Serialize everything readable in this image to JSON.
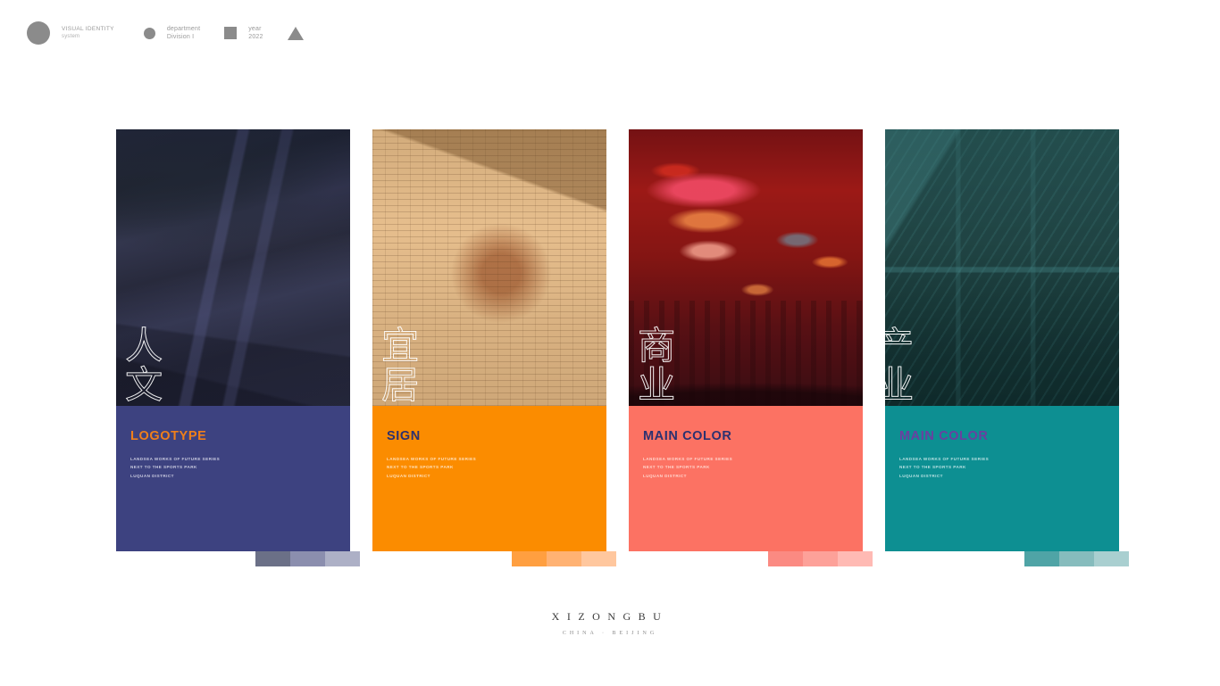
{
  "header": {
    "items": [
      {
        "icon": "circle-large-icon",
        "shape": "circle-lg",
        "line1": "VISUAL IDENTITY",
        "line2": "system"
      },
      {
        "icon": "circle-small-icon",
        "shape": "circle-sm",
        "line1": "department",
        "line2": "Division I"
      },
      {
        "icon": "square-icon",
        "shape": "square",
        "line1": "year",
        "line2": "2022"
      },
      {
        "icon": "triangle-icon",
        "shape": "triangle",
        "line1": "",
        "line2": ""
      }
    ]
  },
  "cards": [
    {
      "name": "logotype",
      "cjk": "人文",
      "title": "LOGOTYPE",
      "lines": [
        "LANDSEA WORKS OF FUTURE SERIES",
        "NEXT TO THE SPORTS PARK",
        "LUQUAN DISTRICT"
      ],
      "panel_color": "#3d4280",
      "title_color": "#f07f1a",
      "text_color": "#c9cadf",
      "tint_color": "#3d4280",
      "swatches": [
        "#6b7087",
        "#8b8eae",
        "#adb0c6"
      ]
    },
    {
      "name": "sign",
      "cjk": "宜居",
      "title": "SIGN",
      "lines": [
        "LANDSEA WORKS OF FUTURE SERIES",
        "NEXT TO THE SPORTS PARK",
        "LUQUAN DISTRICT"
      ],
      "panel_color": "#fb8c00",
      "title_color": "#2c3170",
      "text_color": "#ffe0bb",
      "tint_color": "#d2882f",
      "swatches": [
        "#ff9f40",
        "#ffb273",
        "#ffc79e"
      ]
    },
    {
      "name": "main-color-coral",
      "cjk": "商业",
      "title": "MAIN COLOR",
      "lines": [
        "LANDSEA WORKS OF FUTURE SERIES",
        "NEXT TO THE SPORTS PARK",
        "LUQUAN DISTRICT"
      ],
      "panel_color": "#fc7263",
      "title_color": "#2c3170",
      "text_color": "#ffd5cd",
      "tint_color": "#e2594f",
      "swatches": [
        "#fb8a82",
        "#fda199",
        "#ffbab4"
      ]
    },
    {
      "name": "main-color-teal",
      "cjk": "产业",
      "title": "MAIN COLOR",
      "lines": [
        "LANDSEA WORKS OF FUTURE SERIES",
        "NEXT TO THE SPORTS PARK",
        "LUQUAN DISTRICT"
      ],
      "panel_color": "#0d8f92",
      "title_color": "#6b3fa0",
      "text_color": "#b6e0e1",
      "tint_color": "#10757a",
      "swatches": [
        "#4fa4a6",
        "#86bcbd",
        "#a9cfd0"
      ]
    }
  ],
  "footer": {
    "brand": "XIZONGBU",
    "subtitle": "CHINA · BEIJING"
  }
}
